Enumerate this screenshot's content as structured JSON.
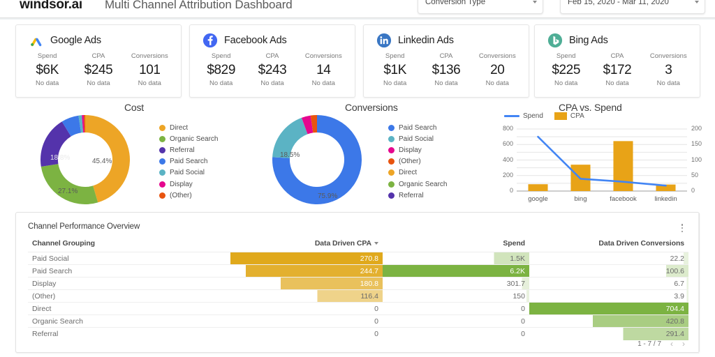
{
  "header": {
    "brand": "windsor.ai",
    "title": "Multi Channel Attribution Dashboard",
    "conversion_type_label": "Conversion Type",
    "date_range_label": "Feb 15, 2020 - Mar 11, 2020"
  },
  "kpi_cards": [
    {
      "channel": "Google Ads",
      "icon": "google-ads-icon",
      "metrics": [
        {
          "label": "Spend",
          "value": "$6K",
          "sub": "No data"
        },
        {
          "label": "CPA",
          "value": "$245",
          "sub": "No data"
        },
        {
          "label": "Conversions",
          "value": "101",
          "sub": "No data"
        }
      ]
    },
    {
      "channel": "Facebook Ads",
      "icon": "facebook-ads-icon",
      "metrics": [
        {
          "label": "Spend",
          "value": "$829",
          "sub": "No data"
        },
        {
          "label": "CPA",
          "value": "$243",
          "sub": "No data"
        },
        {
          "label": "Conversions",
          "value": "14",
          "sub": "No data"
        }
      ]
    },
    {
      "channel": "Linkedin Ads",
      "icon": "linkedin-ads-icon",
      "metrics": [
        {
          "label": "Spend",
          "value": "$1K",
          "sub": "No data"
        },
        {
          "label": "CPA",
          "value": "$136",
          "sub": "No data"
        },
        {
          "label": "Conversions",
          "value": "20",
          "sub": "No data"
        }
      ]
    },
    {
      "channel": "Bing Ads",
      "icon": "bing-ads-icon",
      "metrics": [
        {
          "label": "Spend",
          "value": "$225",
          "sub": "No data"
        },
        {
          "label": "CPA",
          "value": "$172",
          "sub": "No data"
        },
        {
          "label": "Conversions",
          "value": "3",
          "sub": "No data"
        }
      ]
    }
  ],
  "chart_data": [
    {
      "type": "pie",
      "title": "Cost",
      "legend_position": "right",
      "labels": [
        "Direct",
        "Organic Search",
        "Referral",
        "Paid Search",
        "Paid Social",
        "Display",
        "(Other)"
      ],
      "values": [
        45.4,
        27.1,
        18.8,
        6.3,
        1.2,
        0.7,
        0.5
      ],
      "colors": [
        "#eda526",
        "#7cb342",
        "#5433ab",
        "#3c78e8",
        "#5bb3c4",
        "#e5078e",
        "#e8540f"
      ],
      "shown_labels": [
        {
          "text": "45.4%",
          "slice": "Direct"
        },
        {
          "text": "27.1%",
          "slice": "Organic Search"
        },
        {
          "text": "18.8%",
          "slice": "Referral"
        }
      ]
    },
    {
      "type": "pie",
      "title": "Conversions",
      "legend_position": "right",
      "labels": [
        "Paid Search",
        "Paid Social",
        "Display",
        "(Other)",
        "Direct",
        "Organic Search",
        "Referral"
      ],
      "values": [
        75.9,
        18.5,
        3.3,
        2.3,
        0.0,
        0.0,
        0.0
      ],
      "colors": [
        "#3c78e8",
        "#5bb3c4",
        "#e5078e",
        "#e8540f",
        "#eda526",
        "#7cb342",
        "#5433ab"
      ],
      "shown_labels": [
        {
          "text": "75.9%",
          "slice": "Paid Search"
        },
        {
          "text": "18.5%",
          "slice": "Paid Social"
        }
      ]
    },
    {
      "type": "bar",
      "title": "CPA vs. Spend",
      "categories": [
        "google",
        "bing",
        "facebook",
        "linkedin"
      ],
      "series": [
        {
          "name": "CPA",
          "type": "bar",
          "axis": "right",
          "values": [
            22,
            85,
            161,
            21
          ],
          "color": "#e8a317"
        },
        {
          "name": "Spend",
          "type": "line",
          "axis": "left",
          "values": [
            700,
            158,
            120,
            70
          ],
          "color": "#4285f4"
        }
      ],
      "left_axis": {
        "label": "",
        "ticks": [
          "0",
          "200",
          "400",
          "600",
          "800"
        ],
        "min": 0,
        "max": 800
      },
      "right_axis": {
        "label": "",
        "ticks": [
          "0",
          "50",
          "100",
          "150",
          "200"
        ],
        "min": 0,
        "max": 200
      },
      "grid": true,
      "legend_position": "top-left"
    }
  ],
  "table": {
    "title": "Channel Performance Overview",
    "kebab_icon": "more-vertical-icon",
    "columns": [
      {
        "label": "Channel Grouping",
        "align": "left"
      },
      {
        "label": "Data Driven CPA",
        "align": "right",
        "sorted": true
      },
      {
        "label": "Spend",
        "align": "right"
      },
      {
        "label": "Data Driven Conversions",
        "align": "right"
      }
    ],
    "rows": [
      {
        "channel": "Paid Social",
        "cpa": "270.8",
        "spend": "1.5K",
        "conv": "22.2",
        "cpa_fill": 1.0,
        "spend_fill": 0.24,
        "conv_fill": 0.03
      },
      {
        "channel": "Paid Search",
        "cpa": "244.7",
        "spend": "6.2K",
        "conv": "100.6",
        "cpa_fill": 0.9,
        "spend_fill": 1.0,
        "conv_fill": 0.14
      },
      {
        "channel": "Display",
        "cpa": "180.8",
        "spend": "301.7",
        "conv": "6.7",
        "cpa_fill": 0.67,
        "spend_fill": 0.05,
        "conv_fill": 0.01
      },
      {
        "channel": "(Other)",
        "cpa": "116.4",
        "spend": "150",
        "conv": "3.9",
        "cpa_fill": 0.43,
        "spend_fill": 0.02,
        "conv_fill": 0.01
      },
      {
        "channel": "Direct",
        "cpa": "0",
        "spend": "0",
        "conv": "704.4",
        "cpa_fill": 0.0,
        "spend_fill": 0.0,
        "conv_fill": 1.0
      },
      {
        "channel": "Organic Search",
        "cpa": "0",
        "spend": "0",
        "conv": "420.8",
        "cpa_fill": 0.0,
        "spend_fill": 0.0,
        "conv_fill": 0.6
      },
      {
        "channel": "Referral",
        "cpa": "0",
        "spend": "0",
        "conv": "291.4",
        "cpa_fill": 0.0,
        "spend_fill": 0.0,
        "conv_fill": 0.41
      }
    ],
    "pagination": {
      "text": "1 - 7 / 7",
      "prev_icon": "chevron-left-icon",
      "next_icon": "chevron-right-icon"
    }
  },
  "colors": {
    "cpa_ramp": "#e0a91c",
    "spend_ramp": "#7cb342",
    "conv_ramp": "#7cb342"
  }
}
